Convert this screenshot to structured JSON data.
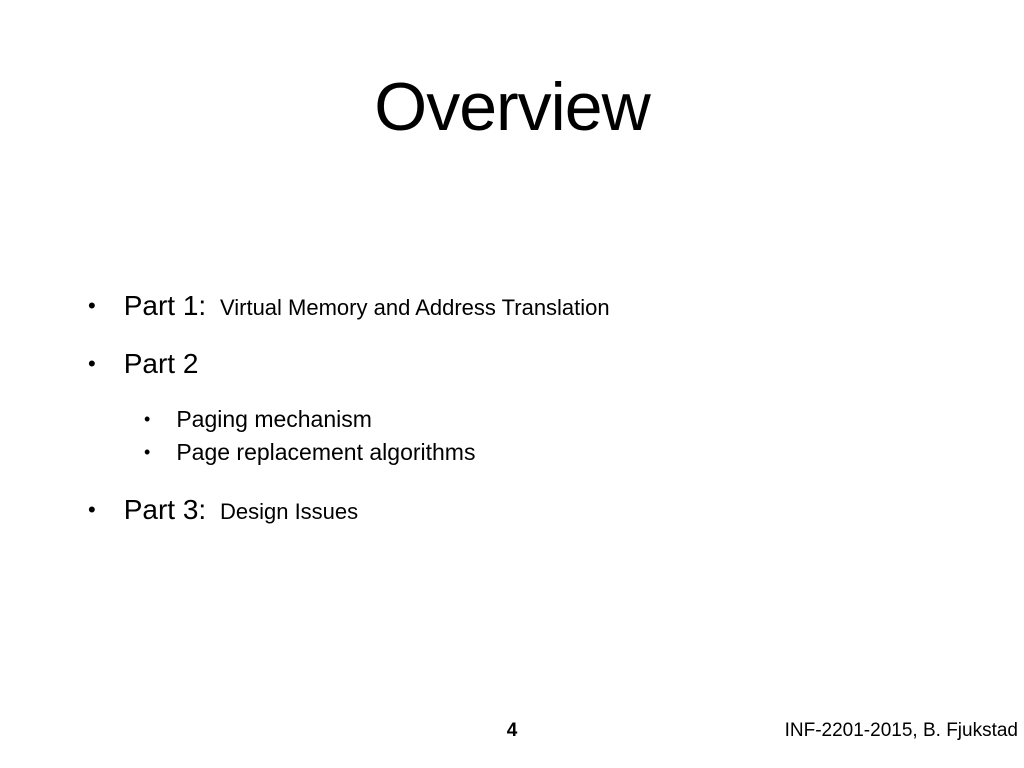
{
  "title": "Overview",
  "bullets": {
    "part1_label": "Part 1:",
    "part1_sub": "Virtual Memory and Address Translation",
    "part2_label": "Part 2",
    "part2_items": {
      "item1": "Paging mechanism",
      "item2": "Page replacement algorithms"
    },
    "part3_label": "Part 3:",
    "part3_sub": "Design Issues"
  },
  "page_number": "4",
  "footer": "INF-2201-2015, B. Fjukstad"
}
